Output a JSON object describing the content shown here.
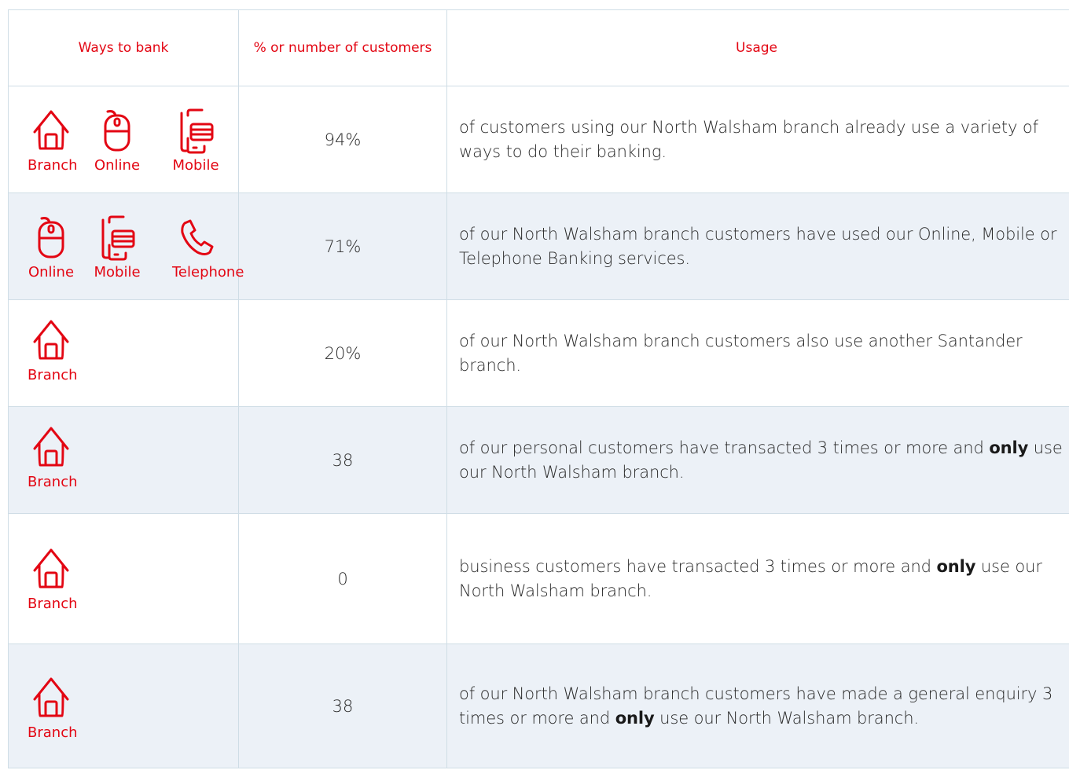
{
  "headers": {
    "ways": "Ways to bank",
    "number": "% or number of customers",
    "usage": "Usage"
  },
  "colors": {
    "accent": "#e30613",
    "row_shade": "#ecf1f7",
    "border": "#cfdde6"
  },
  "icons": {
    "branch": "house-icon",
    "online": "mouse-icon",
    "mobile": "mobile-card-icon",
    "telephone": "phone-icon"
  },
  "rows": [
    {
      "icons": [
        {
          "type": "branch",
          "label": "Branch"
        },
        {
          "type": "online",
          "label": "Online"
        },
        {
          "type": "mobile",
          "label": "Mobile"
        }
      ],
      "value": "94%",
      "text_a": "of customers using our North Walsham branch already use a variety of ways to do their banking.",
      "text_bold": "",
      "text_b": ""
    },
    {
      "icons": [
        {
          "type": "online",
          "label": "Online"
        },
        {
          "type": "mobile",
          "label": "Mobile"
        },
        {
          "type": "telephone",
          "label": "Telephone"
        }
      ],
      "value": "71%",
      "text_a": "of our North Walsham branch customers have used our Online, Mobile or Telephone Banking services.",
      "text_bold": "",
      "text_b": ""
    },
    {
      "icons": [
        {
          "type": "branch",
          "label": "Branch"
        }
      ],
      "value": "20%",
      "text_a": "of our North Walsham branch customers also use another Santander branch.",
      "text_bold": "",
      "text_b": ""
    },
    {
      "icons": [
        {
          "type": "branch",
          "label": "Branch"
        }
      ],
      "value": "38",
      "text_a": "of our personal customers have transacted 3 times or more and ",
      "text_bold": "only",
      "text_b": " use our North Walsham branch."
    },
    {
      "icons": [
        {
          "type": "branch",
          "label": "Branch"
        }
      ],
      "value": "0",
      "text_a": "business customers have transacted 3 times or more and ",
      "text_bold": "only",
      "text_b": " use our North Walsham branch."
    },
    {
      "icons": [
        {
          "type": "branch",
          "label": "Branch"
        }
      ],
      "value": "38",
      "text_a": "of our North Walsham branch customers have made a general enquiry 3 times or more and ",
      "text_bold": "only",
      "text_b": " use our North Walsham branch."
    }
  ]
}
